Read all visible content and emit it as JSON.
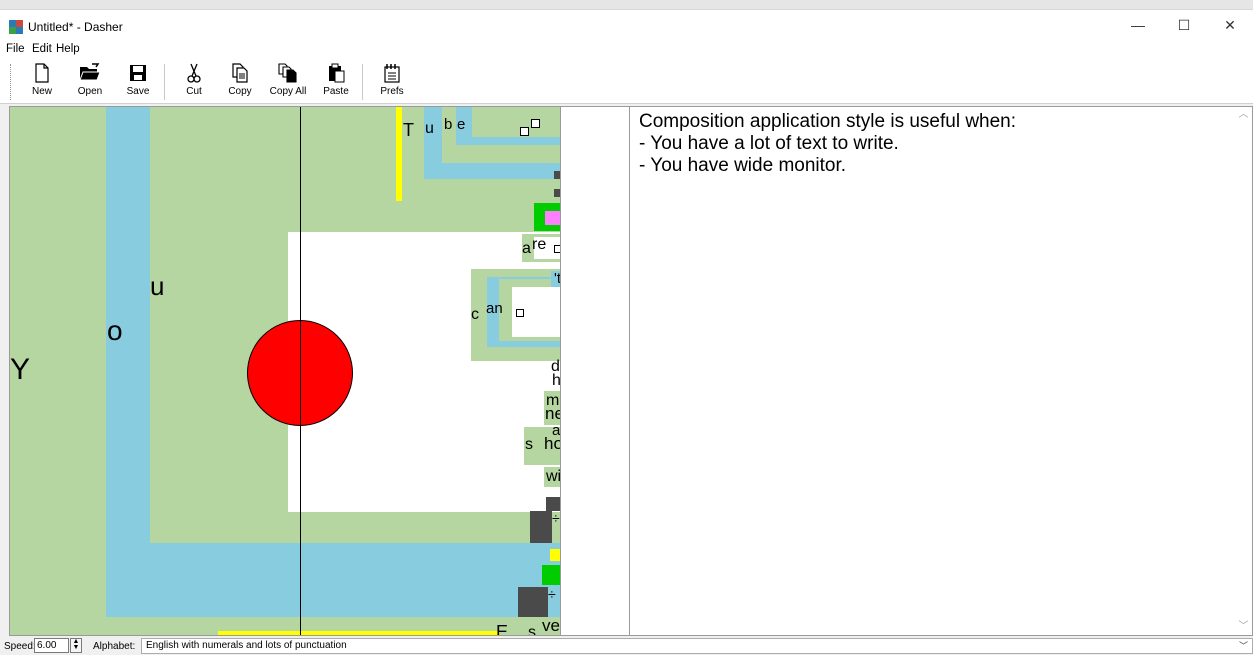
{
  "window": {
    "title": "Untitled* - Dasher",
    "minimize": "—",
    "maximize": "☐",
    "close": "✕"
  },
  "menu": {
    "items": [
      "File",
      "Edit",
      "Help"
    ]
  },
  "toolbar": {
    "new": "New",
    "open": "Open",
    "save": "Save",
    "cut": "Cut",
    "copy": "Copy",
    "copy_all": "Copy All",
    "paste": "Paste",
    "prefs": "Prefs"
  },
  "canvas": {
    "letters": {
      "Y": "Y",
      "o": "o",
      "u": "u",
      "T": "T",
      "u2": "u",
      "b": "b",
      "e": "e",
      "a": "a",
      "re": "re",
      "t": "'t",
      "c": "c",
      "an": "an",
      "do": "do",
      "h": "h",
      "m": "m",
      "need": "need",
      "a2": "a",
      "s": "s",
      "hould": "hould",
      "wi": "wi",
      "plus1": "÷",
      "plus2": "÷",
      "E": "E",
      "s2": "s",
      "ve": "ve"
    },
    "pointer_color": "#ff0000"
  },
  "editor": {
    "lines": [
      "Composition application style is useful when:",
      "- You have a lot of text to write.",
      "- You have wide monitor."
    ]
  },
  "status": {
    "speed_label": "Speed:",
    "speed_value": "6.00",
    "alphabet_label": "Alphabet:",
    "alphabet_value": "English with numerals and lots of punctuation"
  }
}
